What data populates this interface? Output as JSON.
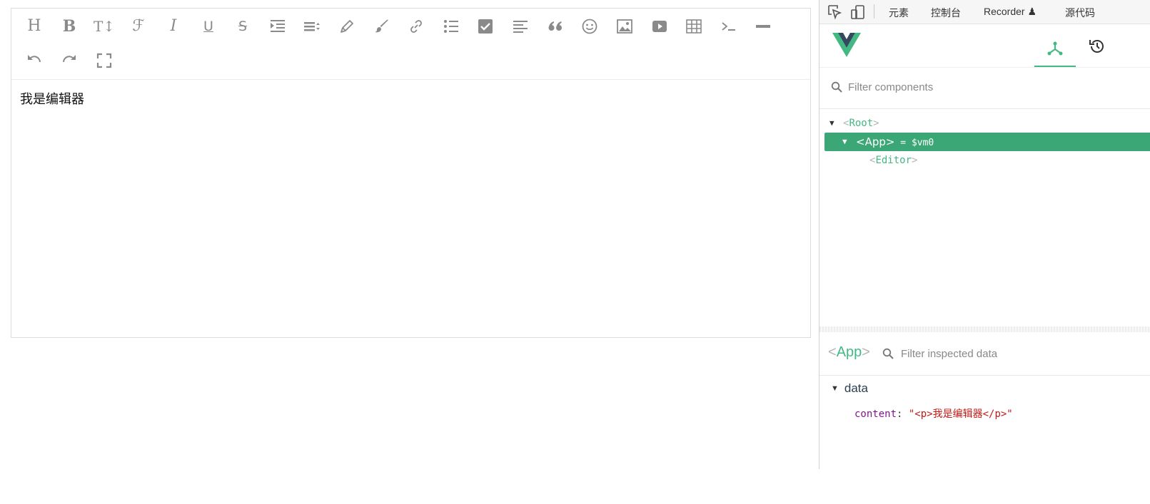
{
  "editor": {
    "toolbar_row1": [
      {
        "icon": "heading-icon",
        "text": "H"
      },
      {
        "icon": "bold-icon",
        "text": "B"
      },
      {
        "icon": "text-size-icon",
        "text": "T↕"
      },
      {
        "icon": "font-icon",
        "text": "ℱ"
      },
      {
        "icon": "italic-icon",
        "text": "I"
      },
      {
        "icon": "underline-icon",
        "text": "U"
      },
      {
        "icon": "strikethrough-icon",
        "text": "S"
      },
      {
        "icon": "indent-icon"
      },
      {
        "icon": "line-height-icon"
      },
      {
        "icon": "pen-icon"
      },
      {
        "icon": "brush-icon"
      },
      {
        "icon": "link-icon"
      },
      {
        "icon": "list-icon"
      },
      {
        "icon": "checkbox-icon"
      },
      {
        "icon": "align-icon"
      },
      {
        "icon": "quote-icon"
      },
      {
        "icon": "emoji-icon"
      },
      {
        "icon": "image-icon"
      },
      {
        "icon": "video-icon"
      },
      {
        "icon": "table-icon"
      },
      {
        "icon": "code-icon"
      },
      {
        "icon": "horizontal-rule-icon"
      }
    ],
    "toolbar_row2": [
      {
        "icon": "undo-icon"
      },
      {
        "icon": "redo-icon"
      },
      {
        "icon": "fullscreen-icon"
      }
    ],
    "content": "我是编辑器"
  },
  "devtools": {
    "topbar": {
      "elements_tab": "元素",
      "console_tab": "控制台",
      "recorder_tab": "Recorder ♟",
      "sources_tab": "源代码"
    },
    "filter_components_placeholder": "Filter components",
    "tree": {
      "root": "Root",
      "app": "App",
      "app_suffix": " = $vm0",
      "editor": "Editor"
    },
    "inspect": {
      "component": "App",
      "filter_placeholder": "Filter inspected data"
    },
    "data": {
      "section": "data",
      "key": "content",
      "value": "\"<p>我是编辑器</p>\""
    },
    "colors": {
      "vue_green": "#42b983",
      "selected_row": "#3ba776"
    }
  }
}
